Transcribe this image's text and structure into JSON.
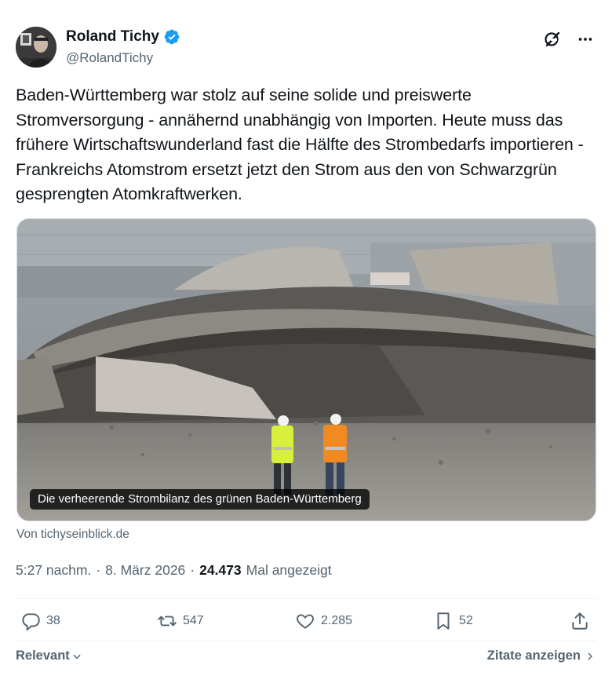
{
  "author": {
    "display_name": "Roland Tichy",
    "handle": "@RolandTichy",
    "verified_color": "#1d9bf0"
  },
  "top_actions": {
    "grok_icon": "grok-icon",
    "more_icon": "more-icon"
  },
  "tweet": {
    "text": "Baden-Württemberg war stolz auf seine solide und preiswerte Stromversorgung - annähernd unabhängig von Importen. Heute muss das frühere Wirtschaftswunderland fast die Hälfte des Strombedarfs importieren - Frankreichs Atomstrom ersetzt jetzt den Strom aus den von Schwarzgrün gesprengten Atomkraftwerken."
  },
  "media": {
    "caption": "Die verheerende Strombilanz des grünen Baden-Württemberg",
    "source": "Von tichyseinblick.de"
  },
  "meta": {
    "time": "5:27 nachm.",
    "sep1": "·",
    "date": "8. März 2026",
    "sep2": "·",
    "views": "24.473",
    "views_label": "Mal angezeigt"
  },
  "actions": {
    "replies": "38",
    "reposts": "547",
    "likes": "2.285",
    "bookmarks": "52"
  },
  "footer": {
    "sort_label": "Relevant",
    "quotes_label": "Zitate anzeigen"
  }
}
